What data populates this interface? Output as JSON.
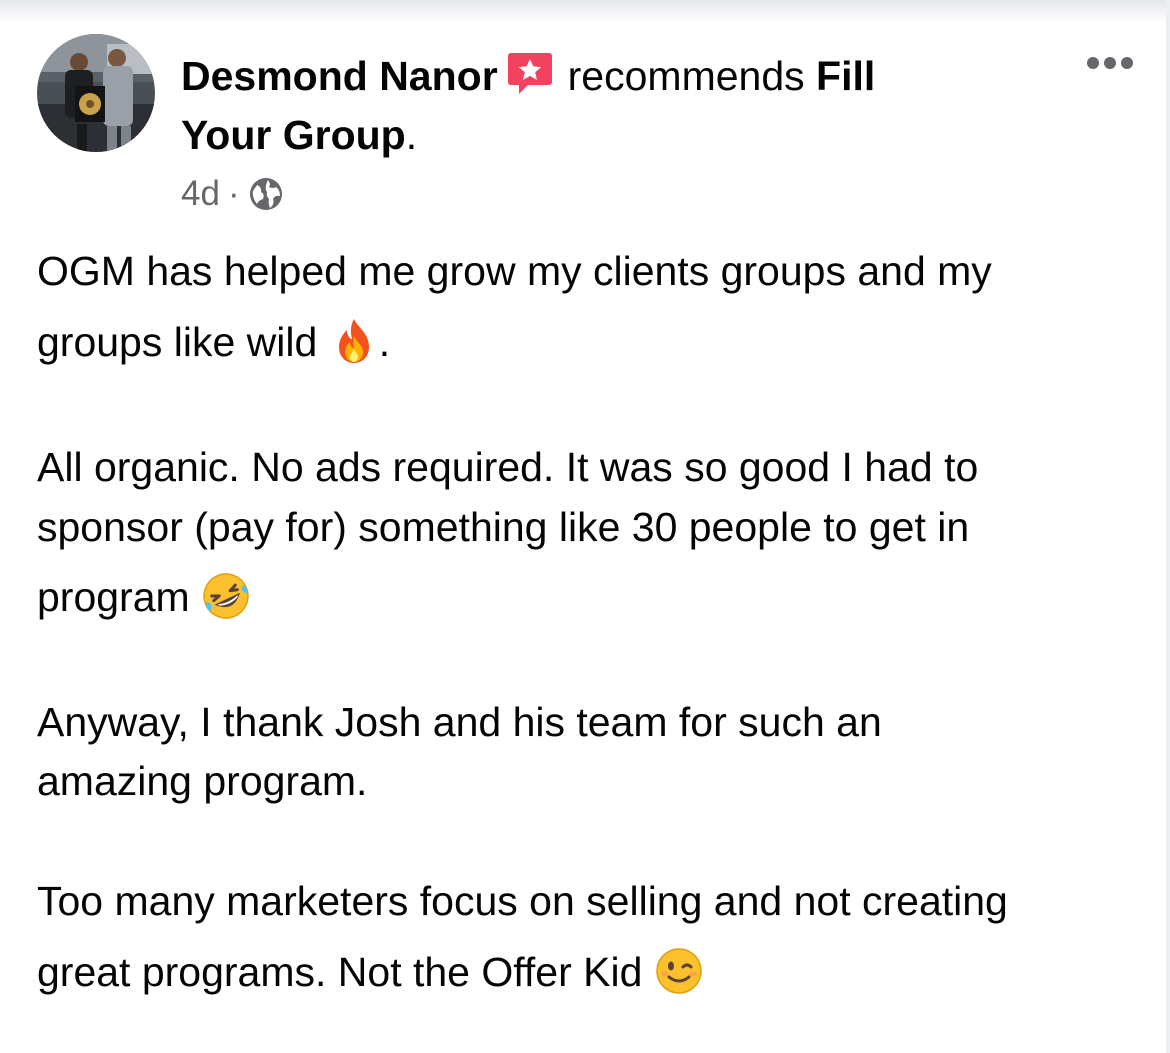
{
  "post": {
    "author_name": "Desmond Nanor",
    "action_text": "recommends",
    "page_name_part1": "Fill",
    "page_name_part2": "Your Group",
    "period": ".",
    "timestamp": "4d",
    "separator": "·",
    "privacy_icon": "globe-icon",
    "recommend_icon": "recommend-star-icon",
    "more_icon": "more-options-icon",
    "body": {
      "p1_line1": "OGM has helped me grow my clients groups and my",
      "p1_line2_text": "groups like wild",
      "p1_line2_emoji": "fire-emoji",
      "p1_line2_end": ".",
      "p2_line1": "All organic. No ads required. It was so good I had to",
      "p2_line2": "sponsor (pay for) something like 30 people to get in",
      "p2_line3_text": "program",
      "p2_line3_emoji": "rolling-laughing-emoji",
      "p3_line1": "Anyway, I thank Josh and his team for such an",
      "p3_line2": "amazing program.",
      "p4_line1": "Too many marketers focus on selling and not creating",
      "p4_line2_text": "great programs. Not the Offer Kid",
      "p4_line2_emoji": "winking-face-emoji"
    }
  },
  "colors": {
    "text": "#050505",
    "secondary_text": "#65676b",
    "recommend_badge": "#f3425f"
  }
}
